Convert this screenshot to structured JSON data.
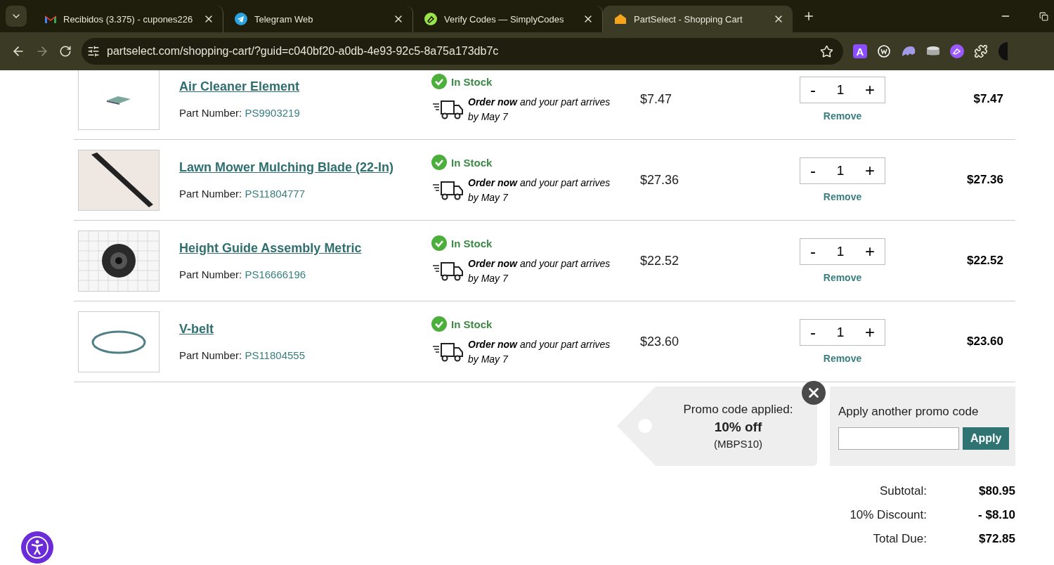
{
  "browser": {
    "tabs": [
      {
        "title": "Recibidos (3.375) - cupones226",
        "selected": false
      },
      {
        "title": "Telegram Web",
        "selected": false
      },
      {
        "title": "Verify Codes — SimplyCodes",
        "selected": false
      },
      {
        "title": "PartSelect - Shopping Cart",
        "selected": true
      }
    ],
    "url": "partselect.com/shopping-cart/?guid=c040bf20-a0db-4e93-92c5-8a75a173db7c",
    "extension_letter": "A"
  },
  "cart": {
    "items": [
      {
        "name": "Air Cleaner Element",
        "part_label": "Part Number:",
        "part_number": "PS9903219",
        "stock": "In Stock",
        "delivery_lead": "Order now",
        "delivery_text": " and your part arrives by May 7",
        "price": "$7.47",
        "quantity": "1",
        "minus": "-",
        "plus": "+",
        "remove": "Remove",
        "total": "$7.47"
      },
      {
        "name": "Lawn Mower Mulching Blade (22-In)",
        "part_label": "Part Number:",
        "part_number": "PS11804777",
        "stock": "In Stock",
        "delivery_lead": "Order now",
        "delivery_text": " and your part arrives by May 7",
        "price": "$27.36",
        "quantity": "1",
        "minus": "-",
        "plus": "+",
        "remove": "Remove",
        "total": "$27.36"
      },
      {
        "name": "Height Guide Assembly Metric",
        "part_label": "Part Number:",
        "part_number": "PS16666196",
        "stock": "In Stock",
        "delivery_lead": "Order now",
        "delivery_text": " and your part arrives by May 7",
        "price": "$22.52",
        "quantity": "1",
        "minus": "-",
        "plus": "+",
        "remove": "Remove",
        "total": "$22.52"
      },
      {
        "name": "V-belt",
        "part_label": "Part Number:",
        "part_number": "PS11804555",
        "stock": "In Stock",
        "delivery_lead": "Order now",
        "delivery_text": " and your part arrives by May 7",
        "price": "$23.60",
        "quantity": "1",
        "minus": "-",
        "plus": "+",
        "remove": "Remove",
        "total": "$23.60"
      }
    ],
    "promo": {
      "applied_label": "Promo code applied:",
      "discount": "10% off",
      "code": "(MBPS10)",
      "another_label": "Apply another promo code",
      "apply": "Apply"
    },
    "summary": [
      {
        "label": "Subtotal:",
        "value": "$80.95"
      },
      {
        "label": "10% Discount:",
        "value": "- $8.10"
      },
      {
        "label": "Total Due:",
        "value": "$72.85"
      }
    ]
  }
}
